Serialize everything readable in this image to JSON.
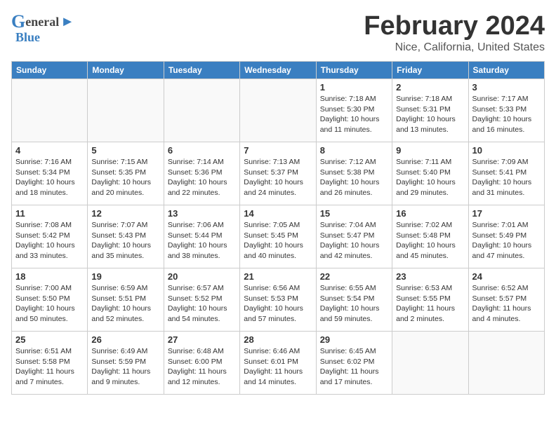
{
  "header": {
    "logo_line1": "General",
    "logo_line2": "Blue",
    "month": "February 2024",
    "location": "Nice, California, United States"
  },
  "weekdays": [
    "Sunday",
    "Monday",
    "Tuesday",
    "Wednesday",
    "Thursday",
    "Friday",
    "Saturday"
  ],
  "weeks": [
    [
      {
        "day": "",
        "info": ""
      },
      {
        "day": "",
        "info": ""
      },
      {
        "day": "",
        "info": ""
      },
      {
        "day": "",
        "info": ""
      },
      {
        "day": "1",
        "info": "Sunrise: 7:18 AM\nSunset: 5:30 PM\nDaylight: 10 hours\nand 11 minutes."
      },
      {
        "day": "2",
        "info": "Sunrise: 7:18 AM\nSunset: 5:31 PM\nDaylight: 10 hours\nand 13 minutes."
      },
      {
        "day": "3",
        "info": "Sunrise: 7:17 AM\nSunset: 5:33 PM\nDaylight: 10 hours\nand 16 minutes."
      }
    ],
    [
      {
        "day": "4",
        "info": "Sunrise: 7:16 AM\nSunset: 5:34 PM\nDaylight: 10 hours\nand 18 minutes."
      },
      {
        "day": "5",
        "info": "Sunrise: 7:15 AM\nSunset: 5:35 PM\nDaylight: 10 hours\nand 20 minutes."
      },
      {
        "day": "6",
        "info": "Sunrise: 7:14 AM\nSunset: 5:36 PM\nDaylight: 10 hours\nand 22 minutes."
      },
      {
        "day": "7",
        "info": "Sunrise: 7:13 AM\nSunset: 5:37 PM\nDaylight: 10 hours\nand 24 minutes."
      },
      {
        "day": "8",
        "info": "Sunrise: 7:12 AM\nSunset: 5:38 PM\nDaylight: 10 hours\nand 26 minutes."
      },
      {
        "day": "9",
        "info": "Sunrise: 7:11 AM\nSunset: 5:40 PM\nDaylight: 10 hours\nand 29 minutes."
      },
      {
        "day": "10",
        "info": "Sunrise: 7:09 AM\nSunset: 5:41 PM\nDaylight: 10 hours\nand 31 minutes."
      }
    ],
    [
      {
        "day": "11",
        "info": "Sunrise: 7:08 AM\nSunset: 5:42 PM\nDaylight: 10 hours\nand 33 minutes."
      },
      {
        "day": "12",
        "info": "Sunrise: 7:07 AM\nSunset: 5:43 PM\nDaylight: 10 hours\nand 35 minutes."
      },
      {
        "day": "13",
        "info": "Sunrise: 7:06 AM\nSunset: 5:44 PM\nDaylight: 10 hours\nand 38 minutes."
      },
      {
        "day": "14",
        "info": "Sunrise: 7:05 AM\nSunset: 5:45 PM\nDaylight: 10 hours\nand 40 minutes."
      },
      {
        "day": "15",
        "info": "Sunrise: 7:04 AM\nSunset: 5:47 PM\nDaylight: 10 hours\nand 42 minutes."
      },
      {
        "day": "16",
        "info": "Sunrise: 7:02 AM\nSunset: 5:48 PM\nDaylight: 10 hours\nand 45 minutes."
      },
      {
        "day": "17",
        "info": "Sunrise: 7:01 AM\nSunset: 5:49 PM\nDaylight: 10 hours\nand 47 minutes."
      }
    ],
    [
      {
        "day": "18",
        "info": "Sunrise: 7:00 AM\nSunset: 5:50 PM\nDaylight: 10 hours\nand 50 minutes."
      },
      {
        "day": "19",
        "info": "Sunrise: 6:59 AM\nSunset: 5:51 PM\nDaylight: 10 hours\nand 52 minutes."
      },
      {
        "day": "20",
        "info": "Sunrise: 6:57 AM\nSunset: 5:52 PM\nDaylight: 10 hours\nand 54 minutes."
      },
      {
        "day": "21",
        "info": "Sunrise: 6:56 AM\nSunset: 5:53 PM\nDaylight: 10 hours\nand 57 minutes."
      },
      {
        "day": "22",
        "info": "Sunrise: 6:55 AM\nSunset: 5:54 PM\nDaylight: 10 hours\nand 59 minutes."
      },
      {
        "day": "23",
        "info": "Sunrise: 6:53 AM\nSunset: 5:55 PM\nDaylight: 11 hours\nand 2 minutes."
      },
      {
        "day": "24",
        "info": "Sunrise: 6:52 AM\nSunset: 5:57 PM\nDaylight: 11 hours\nand 4 minutes."
      }
    ],
    [
      {
        "day": "25",
        "info": "Sunrise: 6:51 AM\nSunset: 5:58 PM\nDaylight: 11 hours\nand 7 minutes."
      },
      {
        "day": "26",
        "info": "Sunrise: 6:49 AM\nSunset: 5:59 PM\nDaylight: 11 hours\nand 9 minutes."
      },
      {
        "day": "27",
        "info": "Sunrise: 6:48 AM\nSunset: 6:00 PM\nDaylight: 11 hours\nand 12 minutes."
      },
      {
        "day": "28",
        "info": "Sunrise: 6:46 AM\nSunset: 6:01 PM\nDaylight: 11 hours\nand 14 minutes."
      },
      {
        "day": "29",
        "info": "Sunrise: 6:45 AM\nSunset: 6:02 PM\nDaylight: 11 hours\nand 17 minutes."
      },
      {
        "day": "",
        "info": ""
      },
      {
        "day": "",
        "info": ""
      }
    ]
  ]
}
